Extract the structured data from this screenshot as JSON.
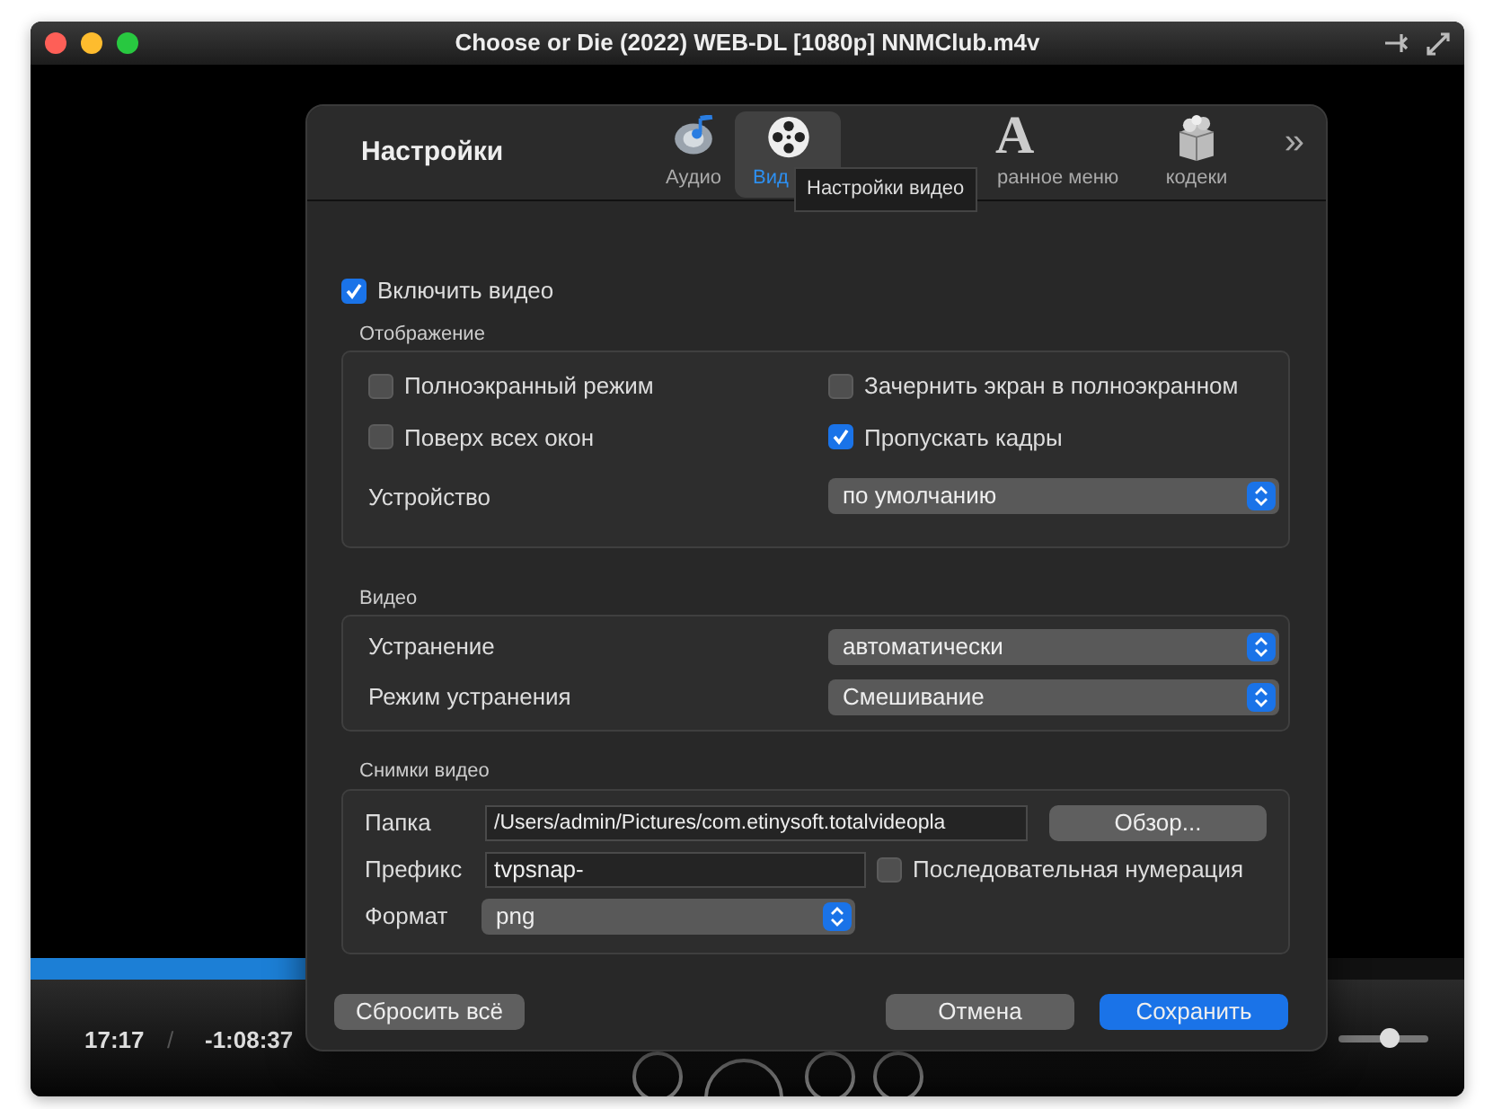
{
  "window": {
    "title": "Choose or Die (2022) WEB-DL [1080p] NNMClub.m4v"
  },
  "player": {
    "progress": {
      "level": 0.3
    },
    "elapsed": "17:17",
    "separator": "/",
    "remaining": "-1:08:37",
    "volume": {
      "level": 0.55
    }
  },
  "dialog": {
    "title": "Настройки",
    "tabs": [
      {
        "kind": "speaker",
        "label": "Аудио",
        "selected": false
      },
      {
        "kind": "reel",
        "label": "Вид",
        "selected": true
      },
      {
        "kind": "letter",
        "glyph": "A",
        "label": "ранное меню",
        "selected": false
      },
      {
        "kind": "box",
        "label": "кодеки",
        "selected": false
      }
    ],
    "more": "»",
    "tooltip": "Настройки видео",
    "enable_video": {
      "label": "Включить видео",
      "checked": true
    },
    "display": {
      "title": "Отображение",
      "options": [
        {
          "label": "Полноэкранный режим",
          "checked": false
        },
        {
          "label": "Зачернить экран в полноэкранном",
          "checked": false
        },
        {
          "label": "Поверх всех окон",
          "checked": false
        },
        {
          "label": "Пропускать кадры",
          "checked": true
        }
      ],
      "device": {
        "label": "Устройство",
        "value": "по умолчанию"
      }
    },
    "video": {
      "title": "Видео",
      "rows": [
        {
          "label": "Устранение",
          "value": "автоматически"
        },
        {
          "label": "Режим устранения",
          "value": "Смешивание"
        }
      ]
    },
    "snapshots": {
      "title": "Снимки видео",
      "folder": {
        "label": "Папка",
        "value": "/Users/admin/Pictures/com.etinysoft.totalvideopla",
        "button": "Обзор..."
      },
      "prefix": {
        "label": "Префикс",
        "value": "tvpsnap-"
      },
      "numbering": {
        "label": "Последовательная нумерация",
        "checked": false
      },
      "format": {
        "label": "Формат",
        "value": "png"
      }
    },
    "buttons": [
      {
        "kind": "plain",
        "label": "Сбросить всё"
      },
      {
        "kind": "plain",
        "label": "Отмена"
      },
      {
        "kind": "primary",
        "label": "Сохранить"
      }
    ]
  }
}
